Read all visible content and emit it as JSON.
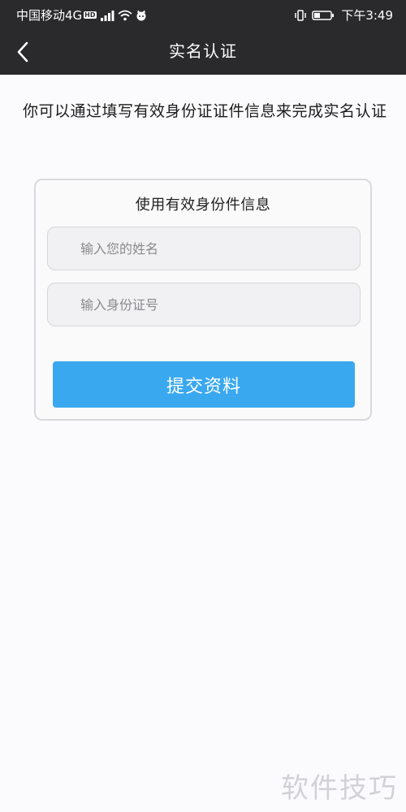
{
  "status_bar": {
    "carrier": "中国移动4G",
    "hd_badge": "HD",
    "time": "下午3:49"
  },
  "header": {
    "title": "实名认证",
    "back_icon": "chevron-left-icon"
  },
  "intro": {
    "text": "你可以通过填写有效身份证证件信息来完成实名认证"
  },
  "form": {
    "title": "使用有效身份件信息",
    "name_field": {
      "placeholder": "输入您的姓名",
      "value": ""
    },
    "id_field": {
      "placeholder": "输入身份证号",
      "value": ""
    },
    "submit_label": "提交资料"
  },
  "watermark": "软件技巧",
  "colors": {
    "header_bg": "#2a2a2c",
    "accent": "#3aa8ef",
    "page_bg": "#fbfafc"
  }
}
